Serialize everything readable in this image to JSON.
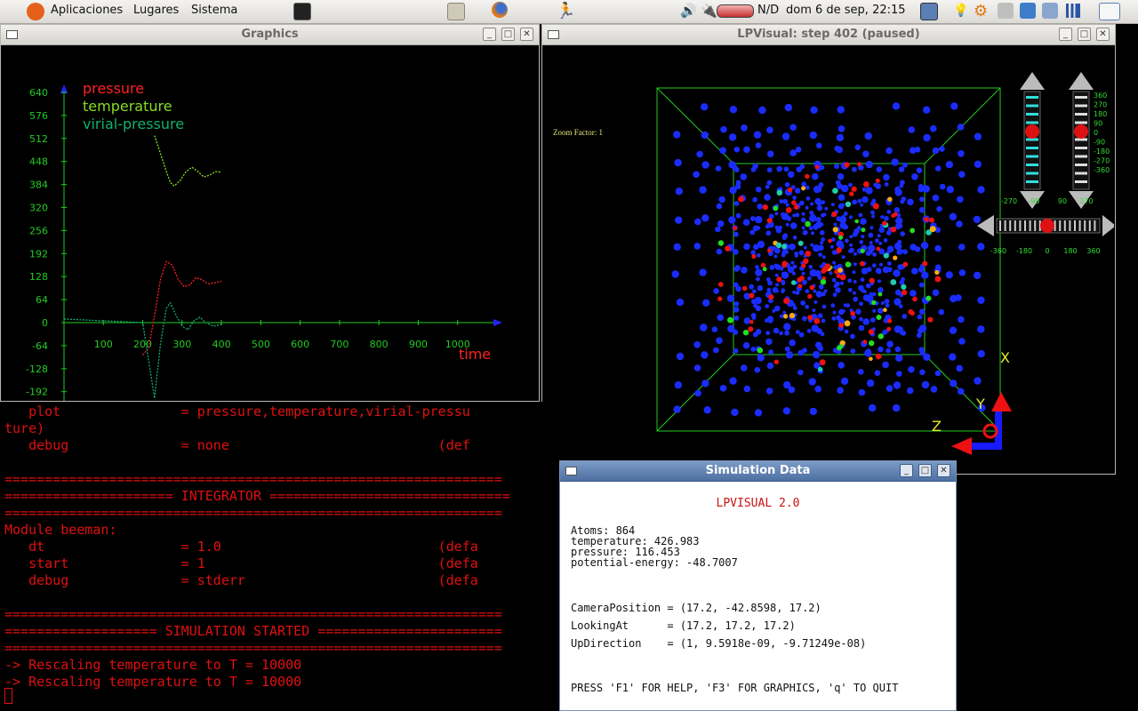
{
  "panel": {
    "menus": [
      "Aplicaciones",
      "Lugares",
      "Sistema"
    ],
    "battery": "N/D",
    "clock": "dom  6 de sep, 22:15"
  },
  "graphics_window": {
    "title": "Graphics",
    "legend": [
      "pressure",
      "temperature",
      "virial-pressure"
    ],
    "x_axis_label": "time"
  },
  "lpvisual_window": {
    "title": "LPVisual: step 402 (paused)",
    "zoom_label": "Zoom Factor: 1",
    "axis_x": "X",
    "axis_y": "Y",
    "axis_z": "Z",
    "vertical_ticks": [
      "360",
      "270",
      "180",
      "90",
      "0",
      "-90",
      "-180",
      "-270",
      "-360"
    ],
    "horizontal_ticks_top": [
      "-270",
      "-90",
      "90",
      "270"
    ],
    "horizontal_ticks_bottom": [
      "-360",
      "-180",
      "0",
      "180",
      "360"
    ]
  },
  "terminal": {
    "lines": [
      "   plot               = pressure,temperature,virial-pressu",
      "ture)",
      "   debug              = none                          (def",
      "",
      "==============================================================",
      "===================== INTEGRATOR ==============================",
      "==============================================================",
      "Module beeman:",
      "   dt                 = 1.0                           (defa",
      "   start              = 1                             (defa",
      "   debug              = stderr                        (defa",
      "",
      "==============================================================",
      "=================== SIMULATION STARTED =======================",
      "==============================================================",
      "-> Rescaling temperature to T = 10000",
      "-> Rescaling temperature to T = 10000"
    ]
  },
  "simulation_window": {
    "title": "Simulation Data",
    "heading": "LPVISUAL 2.0",
    "stats": [
      "Atoms: 864",
      "temperature: 426.983",
      "pressure: 116.453",
      "potential-energy: -48.7007"
    ],
    "camera": [
      "CameraPosition = (17.2, -42.8598, 17.2)",
      "LookingAt      = (17.2, 17.2, 17.2)",
      "UpDirection    = (1, 9.5918e-09, -9.71249e-08)"
    ],
    "help": "PRESS 'F1' FOR HELP, 'F3' FOR GRAPHICS, 'q' TO QUIT"
  },
  "chart_data": {
    "type": "line",
    "xlabel": "time",
    "x_ticks": [
      100,
      200,
      300,
      400,
      500,
      600,
      700,
      800,
      900,
      1000
    ],
    "y_ticks": [
      640,
      576,
      512,
      448,
      384,
      320,
      256,
      192,
      128,
      64,
      0,
      -64,
      -128,
      -192
    ],
    "xlim": [
      0,
      1100
    ],
    "ylim": [
      -210,
      680
    ],
    "series": [
      {
        "name": "pressure",
        "color": "#ff2020",
        "x": [
          200,
          215,
          230,
          245,
          260,
          275,
          290,
          305,
          320,
          335,
          350,
          365,
          380,
          400
        ],
        "y": [
          -90,
          -70,
          20,
          120,
          170,
          160,
          120,
          100,
          105,
          125,
          120,
          108,
          110,
          115
        ]
      },
      {
        "name": "temperature",
        "color": "#88dd22",
        "x": [
          230,
          245,
          260,
          270,
          280,
          295,
          310,
          325,
          340,
          355,
          370,
          385,
          400
        ],
        "y": [
          520,
          470,
          420,
          390,
          380,
          395,
          420,
          432,
          420,
          405,
          410,
          420,
          418
        ]
      },
      {
        "name": "virial-pressure",
        "color": "#10b070",
        "x": [
          0,
          100,
          200,
          230,
          245,
          260,
          270,
          285,
          300,
          315,
          330,
          345,
          360,
          380,
          400
        ],
        "y": [
          10,
          5,
          0,
          -210,
          -60,
          40,
          55,
          20,
          -10,
          -20,
          5,
          15,
          0,
          -10,
          -5
        ]
      }
    ]
  }
}
